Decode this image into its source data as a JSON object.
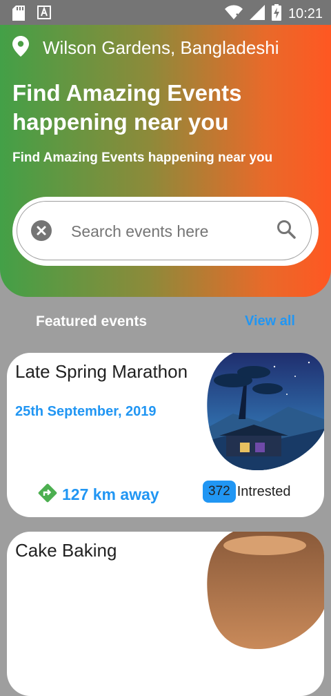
{
  "status_bar": {
    "time": "10:21",
    "left_icons": [
      "sd-card-icon",
      "text-a-icon"
    ],
    "right_icons": [
      "wifi-off-icon",
      "signal-icon",
      "battery-charging-icon"
    ]
  },
  "header": {
    "location": "Wilson Gardens, Bangladeshi",
    "title": "Find Amazing Events happening near you",
    "subtitle": "Find Amazing Events happening near you"
  },
  "search": {
    "placeholder": "Search events here",
    "value": ""
  },
  "featured": {
    "title": "Featured events",
    "view_all": "View all"
  },
  "events": [
    {
      "title": "Late Spring Marathon",
      "date": "25th September, 2019",
      "distance": "127 km away",
      "interested_count": "372",
      "interested_label": "Intrested"
    },
    {
      "title": "Cake Baking"
    }
  ],
  "colors": {
    "accent": "#2196f3",
    "gradient_start": "#43a047",
    "gradient_end": "#ff5722",
    "background": "#9e9e9e"
  }
}
